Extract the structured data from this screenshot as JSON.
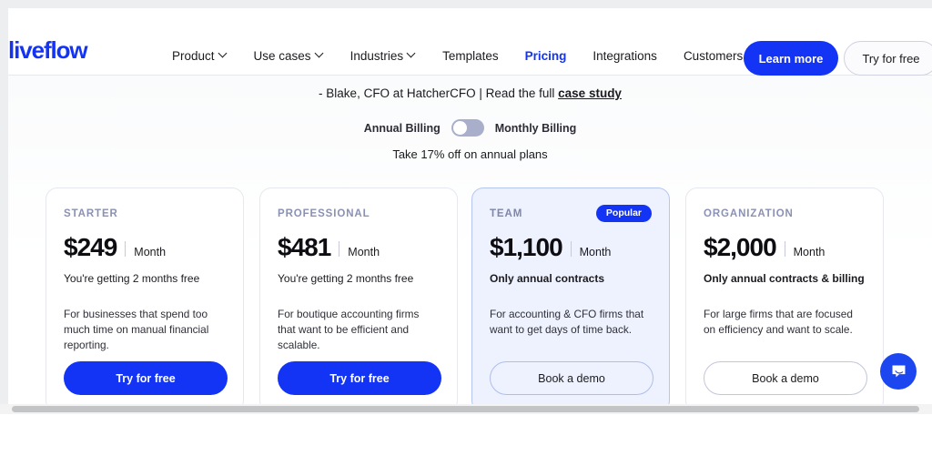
{
  "brand": {
    "logo_text": "liveflow",
    "accent": "#1434f5"
  },
  "header": {
    "nav": [
      {
        "label": "Product",
        "has_caret": true,
        "active": false
      },
      {
        "label": "Use cases",
        "has_caret": true,
        "active": false
      },
      {
        "label": "Industries",
        "has_caret": true,
        "active": false
      },
      {
        "label": "Templates",
        "has_caret": false,
        "active": false
      },
      {
        "label": "Pricing",
        "has_caret": false,
        "active": true
      },
      {
        "label": "Integrations",
        "has_caret": false,
        "active": false
      },
      {
        "label": "Customers",
        "has_caret": false,
        "active": false
      }
    ],
    "learn_more_label": "Learn more",
    "try_free_label": "Try for free"
  },
  "quote": {
    "text": "- Blake, CFO at HatcherCFO | Read the full ",
    "link_label": "case study"
  },
  "billing": {
    "annual_label": "Annual Billing",
    "monthly_label": "Monthly Billing",
    "toggle_state": "annual",
    "discount_text": "Take 17% off on annual plans"
  },
  "plans": [
    {
      "tier": "STARTER",
      "badge": null,
      "price": "$249",
      "period": "Month",
      "note": "You're getting 2 months free",
      "note_bold": false,
      "description": "For businesses that spend too much time on manual financial reporting.",
      "cta_label": "Try for free",
      "cta_style": "primary"
    },
    {
      "tier": "PROFESSIONAL",
      "badge": null,
      "price": "$481",
      "period": "Month",
      "note": "You're getting 2 months free",
      "note_bold": false,
      "description": "For boutique accounting firms that want to be efficient and scalable.",
      "cta_label": "Try for free",
      "cta_style": "primary"
    },
    {
      "tier": "TEAM",
      "badge": "Popular",
      "price": "$1,100",
      "period": "Month",
      "note": "Only annual contracts",
      "note_bold": true,
      "description": "For accounting & CFO firms that want to get days of time back.",
      "cta_label": "Book a demo",
      "cta_style": "ghost"
    },
    {
      "tier": "ORGANIZATION",
      "badge": null,
      "price": "$2,000",
      "period": "Month",
      "note": "Only annual contracts & billing",
      "note_bold": true,
      "description": "For large firms that are focused on efficiency and want to scale.",
      "cta_label": "Book a demo",
      "cta_style": "ghost"
    }
  ],
  "chat_widget": {
    "icon": "chat-bubble-icon",
    "color": "#1b46f0"
  }
}
